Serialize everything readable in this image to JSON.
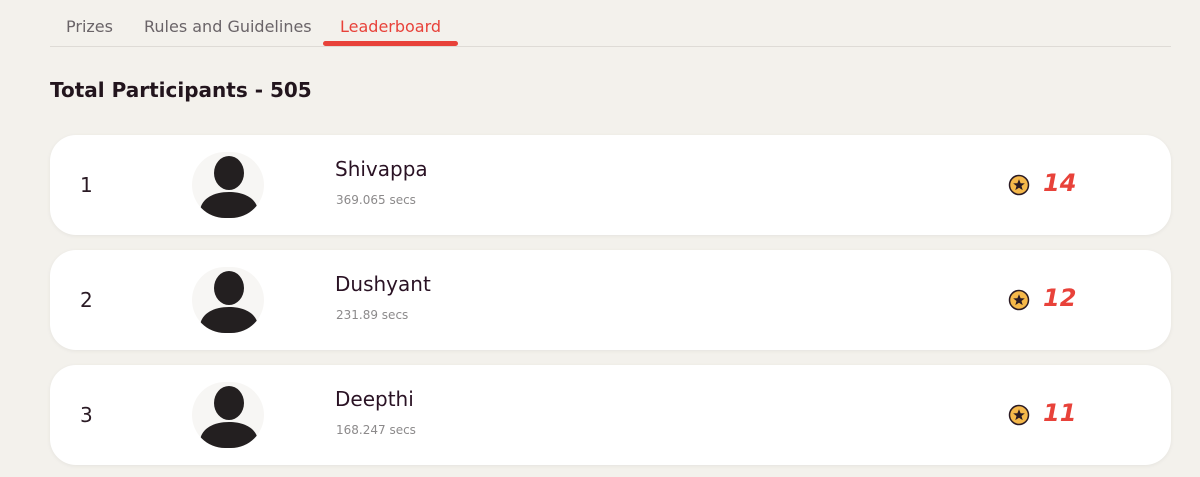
{
  "tabs": [
    {
      "label": "Prizes"
    },
    {
      "label": "Rules and Guidelines"
    },
    {
      "label": "Leaderboard",
      "active": true
    }
  ],
  "header": {
    "title": "Total Participants - 505"
  },
  "colors": {
    "accent": "#e8423a",
    "coin": "#f5b84a",
    "background": "#f3f1ec"
  },
  "leaderboard": [
    {
      "rank": "1",
      "name": "Shivappa",
      "time": "369.065 secs",
      "score": "14",
      "avatar_icon": "user-silhouette-icon",
      "score_icon": "star-coin-icon"
    },
    {
      "rank": "2",
      "name": "Dushyant",
      "time": "231.89 secs",
      "score": "12",
      "avatar_icon": "user-silhouette-icon",
      "score_icon": "star-coin-icon"
    },
    {
      "rank": "3",
      "name": "Deepthi",
      "time": "168.247 secs",
      "score": "11",
      "avatar_icon": "user-silhouette-icon",
      "score_icon": "star-coin-icon"
    }
  ]
}
